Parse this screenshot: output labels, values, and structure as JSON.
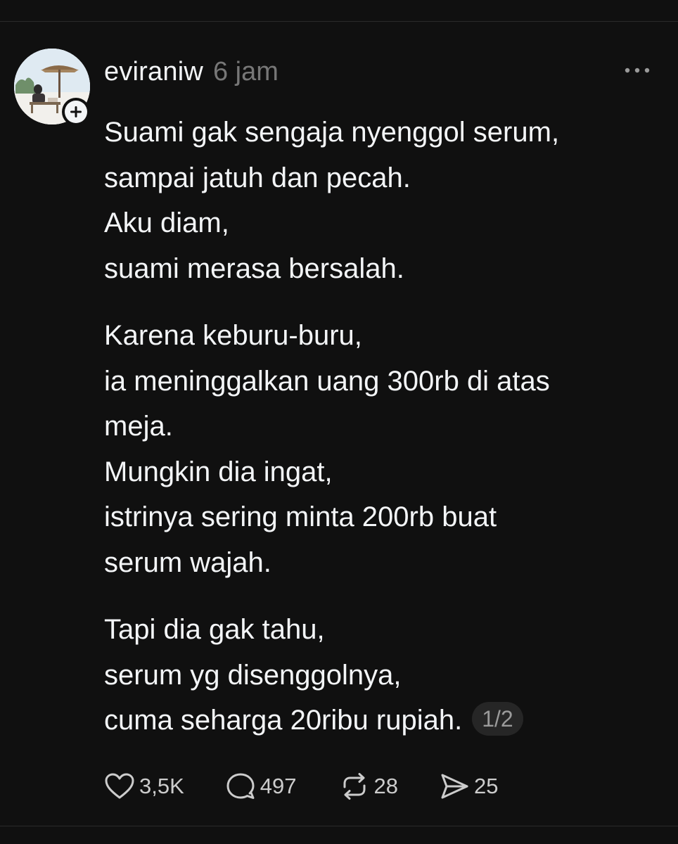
{
  "post": {
    "username": "eviraniw",
    "timestamp": "6 jam",
    "paragraphs": [
      [
        "Suami gak sengaja nyenggol serum,",
        "sampai jatuh dan pecah.",
        "Aku diam,",
        "suami merasa bersalah."
      ],
      [
        "Karena keburu-buru,",
        "ia meninggalkan uang 300rb di atas",
        "meja.",
        "Mungkin dia ingat,",
        "istrinya sering minta 200rb buat",
        "serum wajah."
      ],
      [
        "Tapi dia gak tahu,",
        "serum yg disenggolnya,",
        "cuma seharga 20ribu rupiah."
      ]
    ],
    "thread_pager": "1/2",
    "actions": {
      "like_count": "3,5K",
      "reply_count": "497",
      "repost_count": "28",
      "share_count": "25"
    },
    "icons": {
      "more": "more-horizontal-icon",
      "like": "heart-icon",
      "reply": "comment-bubble-icon",
      "repost": "repost-arrows-icon",
      "share": "send-paper-plane-icon",
      "follow": "plus-icon"
    }
  },
  "colors": {
    "background": "#101010",
    "text_primary": "#f3f5f7",
    "text_secondary": "#777777",
    "pill_background": "#262626"
  }
}
